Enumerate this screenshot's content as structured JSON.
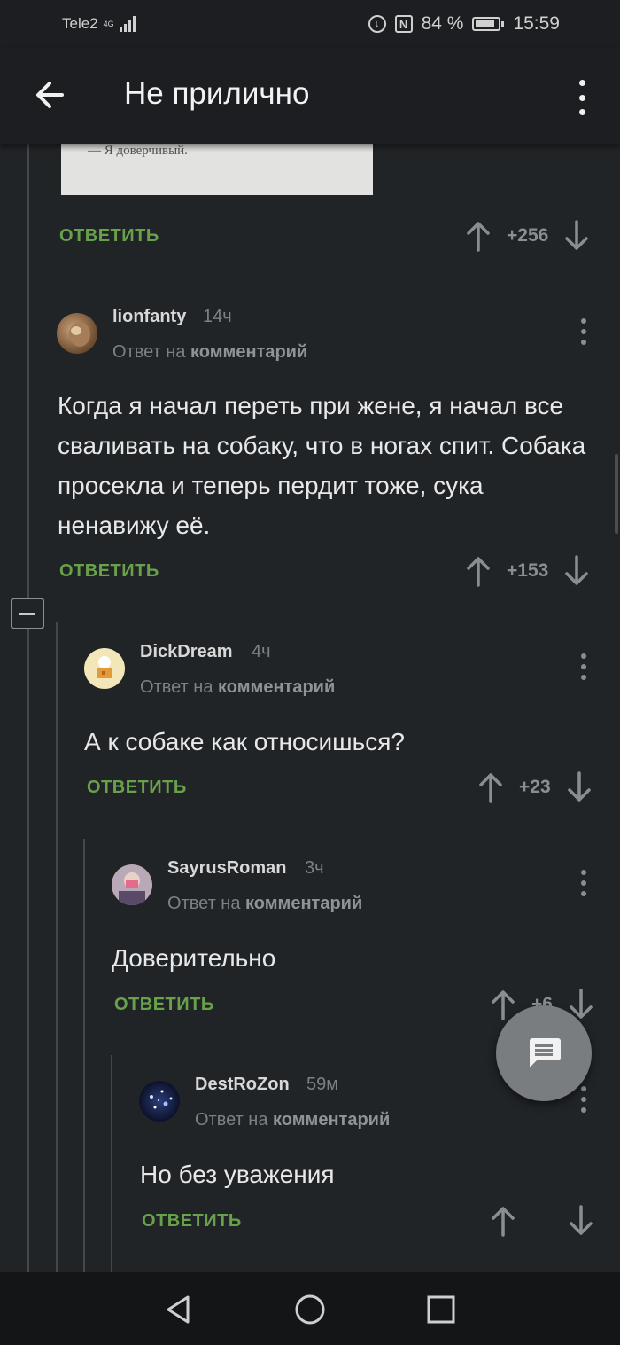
{
  "status_bar": {
    "carrier": "Tele2",
    "network": "4G",
    "nfc": "N",
    "battery": "84 %",
    "battery_level": 0.84,
    "time": "15:59"
  },
  "app_bar": {
    "title": "Не прилично",
    "back_icon": "arrow-left-icon",
    "menu_icon": "more-vertical-icon"
  },
  "image_fragment": {
    "caption": "— Я доверчивый."
  },
  "top_actions": {
    "reply_label": "ОТВЕТИТЬ",
    "score": "+256"
  },
  "comments": [
    {
      "author": "lionfanty",
      "time": "14ч",
      "reply_prefix": "Ответ на",
      "reply_link": "комментарий",
      "text": "Когда я начал переть при жене, я начал все сваливать на собаку, что в ногах спит. Собака просекла и теперь пердит тоже, сука ненавижу её.",
      "reply_label": "ОТВЕТИТЬ",
      "score": "+153"
    },
    {
      "author": "DickDream",
      "time": "4ч",
      "reply_prefix": "Ответ на",
      "reply_link": "комментарий",
      "text": "А к собаке как относишься?",
      "reply_label": "ОТВЕТИТЬ",
      "score": "+23"
    },
    {
      "author": "SayrusRoman",
      "time": "3ч",
      "reply_prefix": "Ответ на",
      "reply_link": "комментарий",
      "text": "Доверительно",
      "reply_label": "ОТВЕТИТЬ",
      "score": "+6"
    },
    {
      "author": "DestRoZon",
      "time": "59м",
      "reply_prefix": "Ответ на",
      "reply_link": "комментарий",
      "text": "Но без уважения",
      "reply_label": "ОТВЕТИТЬ"
    }
  ],
  "fab_icon": "comment-icon",
  "colors": {
    "background": "#212427",
    "bar": "#1c1e21",
    "accent_green": "#69a14b",
    "muted": "#7d8084"
  }
}
